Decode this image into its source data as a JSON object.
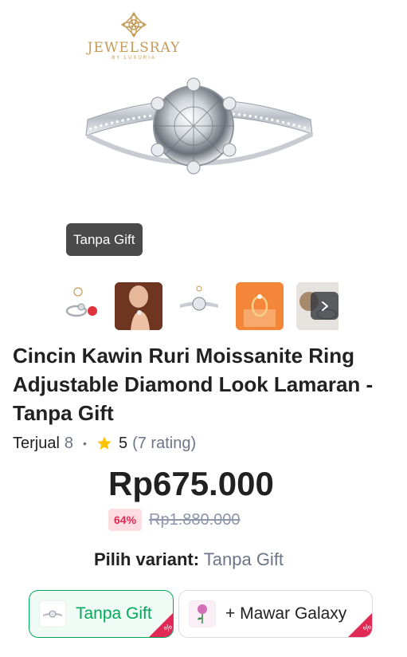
{
  "brand": {
    "name": "JEWELSRAY",
    "sub": "BY LUXURIA"
  },
  "variant_overlay": "Tanpa Gift",
  "gallery": {
    "thumbnails": [
      "ring-product",
      "hand-model",
      "ring-solitaire",
      "ring-orange-box",
      "ring-box"
    ],
    "next_icon": "chevron-right-icon"
  },
  "product": {
    "title": "Cincin Kawin Ruri Moissanite Ring Adjustable Diamond Look Lamaran - Tanpa Gift",
    "sold_label": "Terjual",
    "sold_count": "8",
    "rating": "5",
    "rating_count": "(7 rating)",
    "price": "Rp675.000",
    "discount": "64%",
    "original_price": "Rp1.880.000"
  },
  "variant_picker": {
    "label": "Pilih variant:",
    "selected": "Tanpa Gift",
    "options": [
      {
        "label": "Tanpa Gift",
        "selected": true
      },
      {
        "label": "+ Mawar Galaxy",
        "selected": false
      }
    ]
  },
  "colors": {
    "accent_green": "#00aa5b",
    "discount_red": "#e02954",
    "star": "#ffc400",
    "brand_gold": "#c59a55"
  }
}
